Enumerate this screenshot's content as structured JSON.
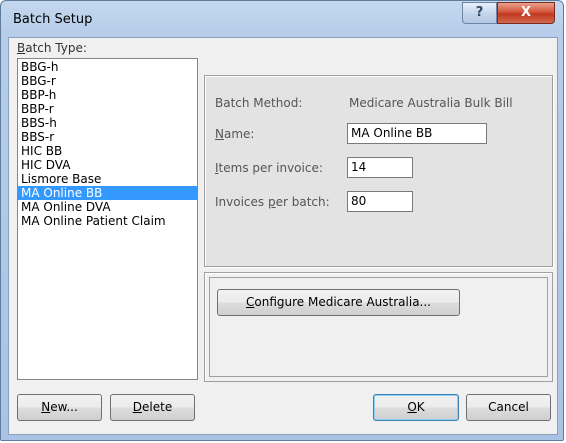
{
  "window": {
    "title": "Batch Setup",
    "help_glyph": "?",
    "close_glyph": "X"
  },
  "batch_type": {
    "label_prefix": "B",
    "label_rest": "atch Type:",
    "items": [
      "BBG-h",
      "BBG-r",
      "BBP-h",
      "BBP-r",
      "BBS-h",
      "BBS-r",
      "HIC BB",
      "HIC DVA",
      "Lismore Base",
      "MA Online BB",
      "MA Online DVA",
      "MA Online Patient Claim"
    ],
    "selected": "MA Online BB"
  },
  "details": {
    "batch_method_label": "Batch Method:",
    "batch_method_value": "Medicare Australia Bulk Bill",
    "name_label_u": "N",
    "name_label_rest": "ame:",
    "name_value": "MA Online BB",
    "items_label_u": "I",
    "items_label_rest": "tems per invoice:",
    "items_value": "14",
    "invoices_label_pre": "Invoices ",
    "invoices_label_u": "p",
    "invoices_label_rest": "er batch:",
    "invoices_value": "80"
  },
  "configure": {
    "u": "C",
    "rest": "onfigure Medicare Australia..."
  },
  "buttons": {
    "new_u": "N",
    "new_rest": "ew...",
    "delete_u": "D",
    "delete_rest": "elete",
    "ok_u": "O",
    "ok_rest": "K",
    "cancel": "Cancel"
  }
}
